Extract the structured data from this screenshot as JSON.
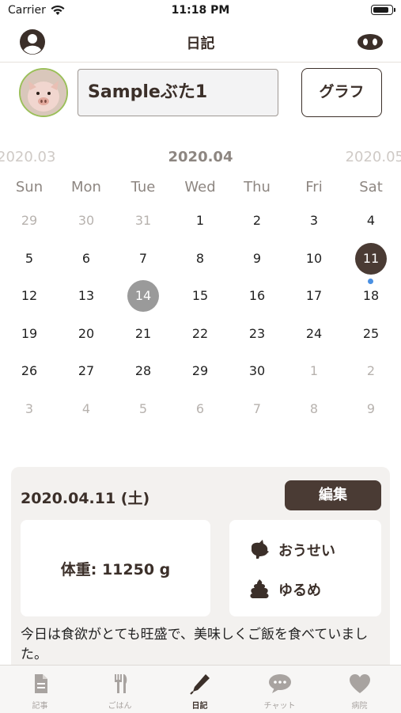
{
  "status_bar": {
    "carrier": "Carrier",
    "time": "11:18 PM",
    "battery_level": 0.9
  },
  "nav": {
    "title": "日記",
    "left_icon": "account-icon",
    "right_icon": "pig-nose-icon"
  },
  "profile": {
    "name": "Sampleぶた1",
    "graph_button": "グラフ"
  },
  "calendar": {
    "prev_month": "2020.03",
    "current_month": "2020.04",
    "next_month": "2020.05",
    "weekdays": [
      "Sun",
      "Mon",
      "Tue",
      "Wed",
      "Thu",
      "Fri",
      "Sat"
    ],
    "weeks": [
      [
        {
          "d": "29",
          "o": true
        },
        {
          "d": "30",
          "o": true
        },
        {
          "d": "31",
          "o": true
        },
        {
          "d": "1"
        },
        {
          "d": "2"
        },
        {
          "d": "3"
        },
        {
          "d": "4"
        }
      ],
      [
        {
          "d": "5"
        },
        {
          "d": "6"
        },
        {
          "d": "7"
        },
        {
          "d": "8"
        },
        {
          "d": "9"
        },
        {
          "d": "10"
        },
        {
          "d": "11",
          "selected": true,
          "event": true
        }
      ],
      [
        {
          "d": "12"
        },
        {
          "d": "13"
        },
        {
          "d": "14",
          "today": true
        },
        {
          "d": "15"
        },
        {
          "d": "16"
        },
        {
          "d": "17"
        },
        {
          "d": "18"
        }
      ],
      [
        {
          "d": "19"
        },
        {
          "d": "20"
        },
        {
          "d": "21"
        },
        {
          "d": "22"
        },
        {
          "d": "23"
        },
        {
          "d": "24"
        },
        {
          "d": "25"
        }
      ],
      [
        {
          "d": "26"
        },
        {
          "d": "27"
        },
        {
          "d": "28"
        },
        {
          "d": "29"
        },
        {
          "d": "30"
        },
        {
          "d": "1",
          "o": true
        },
        {
          "d": "2",
          "o": true
        }
      ],
      [
        {
          "d": "3",
          "o": true
        },
        {
          "d": "4",
          "o": true
        },
        {
          "d": "5",
          "o": true
        },
        {
          "d": "6",
          "o": true
        },
        {
          "d": "7",
          "o": true
        },
        {
          "d": "8",
          "o": true
        },
        {
          "d": "9",
          "o": true
        }
      ]
    ],
    "colors": {
      "selected": "#4a3b34",
      "today": "#9a9a9a",
      "event_dot": "#4a90e2"
    }
  },
  "entry": {
    "date": "2020.04.11 (土)",
    "edit_button": "編集",
    "weight": "体重:  11250 g",
    "stool_shape": "おうせい",
    "stool_condition": "ゆるめ",
    "memo": "今日は食欲がとても旺盛で、美味しくご飯を食べていました。"
  },
  "tabs": [
    {
      "label": "記事",
      "icon": "document-icon"
    },
    {
      "label": "ごはん",
      "icon": "fork-knife-icon"
    },
    {
      "label": "日記",
      "icon": "pen-icon",
      "active": true
    },
    {
      "label": "チャット",
      "icon": "chat-bubble-icon"
    },
    {
      "label": "病院",
      "icon": "heart-icon"
    }
  ]
}
